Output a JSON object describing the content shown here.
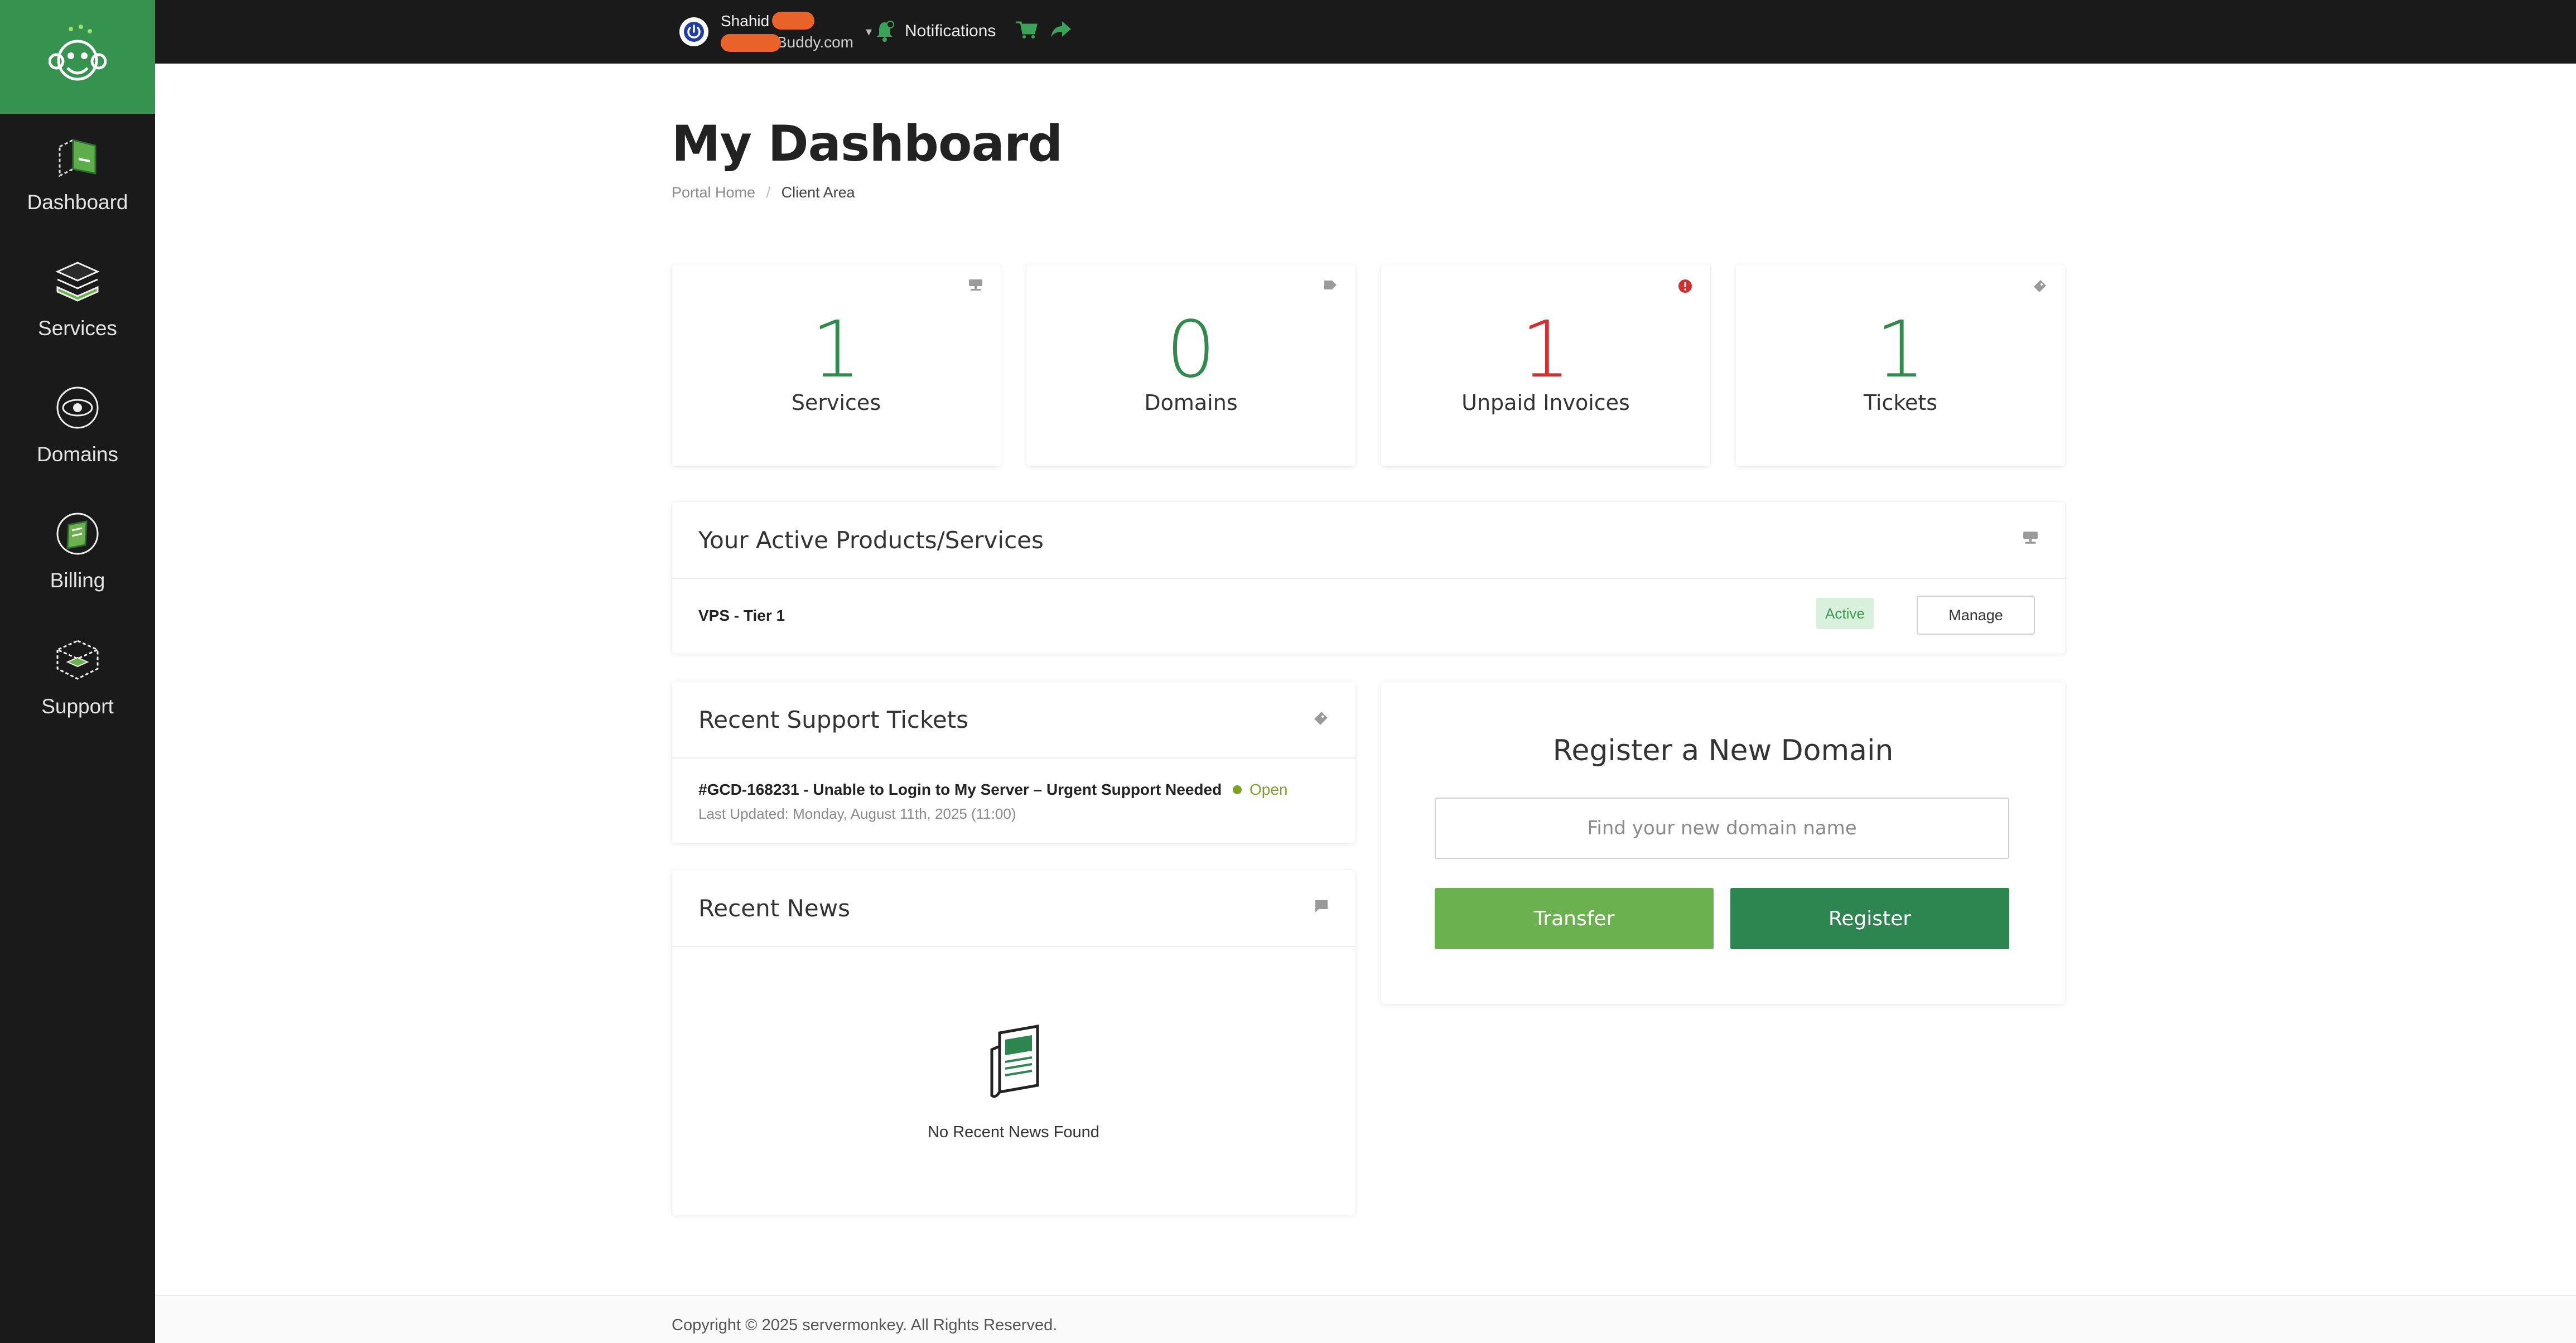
{
  "sidebar": {
    "items": [
      {
        "label": "Dashboard",
        "icon": "dashboard-icon"
      },
      {
        "label": "Services",
        "icon": "services-icon"
      },
      {
        "label": "Domains",
        "icon": "domains-icon"
      },
      {
        "label": "Billing",
        "icon": "billing-icon"
      },
      {
        "label": "Support",
        "icon": "support-icon"
      }
    ]
  },
  "topbar": {
    "user_name": "Shahid",
    "user_email_suffix": "Buddy.com",
    "notifications_label": "Notifications"
  },
  "page": {
    "title": "My Dashboard",
    "breadcrumb": [
      "Portal Home",
      "Client Area"
    ]
  },
  "stats": [
    {
      "value": "1",
      "label": "Services",
      "icon": "server-icon"
    },
    {
      "value": "0",
      "label": "Domains",
      "icon": "tag-icon"
    },
    {
      "value": "1",
      "label": "Unpaid Invoices",
      "icon": "alert-icon"
    },
    {
      "value": "1",
      "label": "Tickets",
      "icon": "ticket-icon"
    }
  ],
  "active_products": {
    "title": "Your Active Products/Services",
    "items": [
      {
        "name": "VPS - Tier 1",
        "status": "Active",
        "action": "Manage"
      }
    ]
  },
  "support_tickets": {
    "title": "Recent Support Tickets",
    "items": [
      {
        "title": "#GCD-168231 - Unable to Login to My Server – Urgent Support Needed",
        "status": "Open",
        "updated": "Last Updated: Monday, August 11th, 2025 (11:00)"
      }
    ]
  },
  "news": {
    "title": "Recent News",
    "empty_text": "No Recent News Found"
  },
  "register_domain": {
    "title": "Register a New Domain",
    "placeholder": "Find your new domain name",
    "transfer_label": "Transfer",
    "register_label": "Register"
  },
  "footer": {
    "text": "Copyright © 2025 servermonkey. All Rights Reserved."
  },
  "colors": {
    "brand_green": "#35924f",
    "dark": "#1a1a1a",
    "stat_green": "#2f8a4c",
    "stat_red": "#d32f2f",
    "transfer_green": "#6cb14f",
    "register_green": "#2d8550"
  }
}
